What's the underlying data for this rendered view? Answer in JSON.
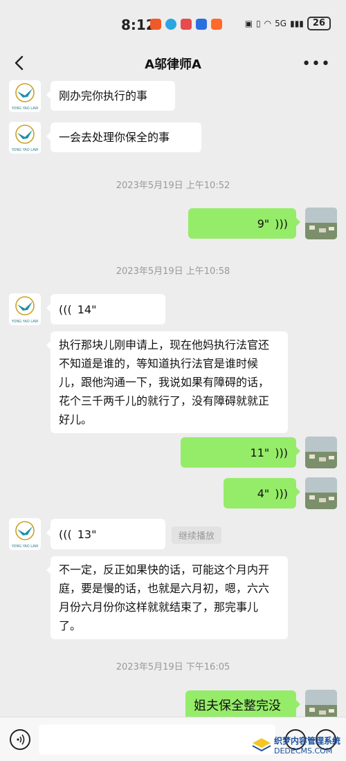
{
  "status_bar": {
    "time": "8:12",
    "battery": "26",
    "network": "5G"
  },
  "nav": {
    "title": "A邬律师A"
  },
  "logo_text": "YONG YAO LAW",
  "messages": {
    "m1": "刚办完你执行的事",
    "m2": "一会去处理你保全的事",
    "ts1": "2023年5月19日 上午10:52",
    "v_out1": "9\"",
    "ts2": "2023年5月19日 上午10:58",
    "v_in1": "14\"",
    "t_in1": "执行那块儿刚申请上，现在他妈执行法官还不知道是谁的，等知道执行法官是谁时候儿，跟他沟通一下，我说如果有障碍的话，花个三千两千儿的就行了，没有障碍就就正好儿。",
    "v_out2": "11\"",
    "v_out3": "4\"",
    "v_in2": "13\"",
    "continue_label": "继续播放",
    "t_in2": "不一定，反正如果快的话，可能这个月内开庭，要是慢的话，也就是六月初，嗯，六六月份六月份你这样就就结束了，那完事儿了。",
    "ts3": "2023年5月19日 下午16:05",
    "t_out1": "姐夫保全整完没"
  },
  "watermark": {
    "line1": "织梦内容管理系统",
    "line2": "DEDECMS.COM"
  },
  "colors": {
    "background": "#ededed",
    "outgoing_bubble": "#95ec69",
    "incoming_bubble": "#ffffff",
    "timestamp": "#999999"
  }
}
